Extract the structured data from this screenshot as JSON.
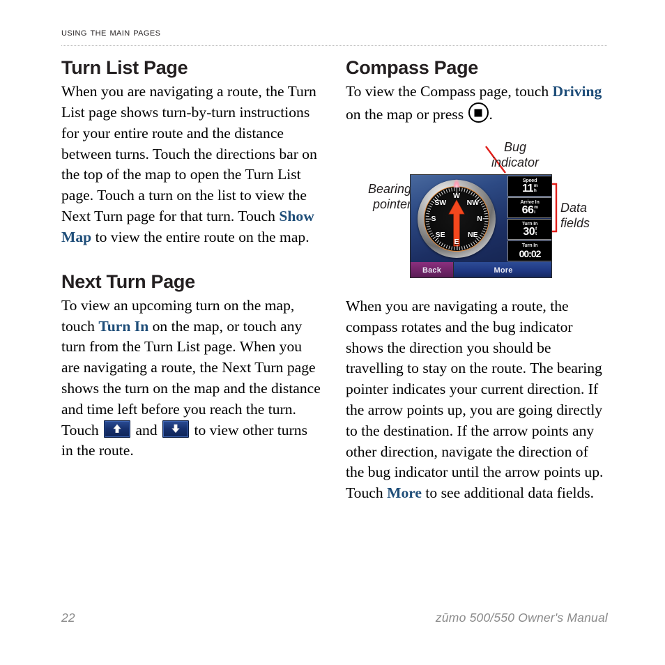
{
  "header": {
    "title": "Using the Main Pages"
  },
  "left_column": {
    "section1": {
      "title": "Turn List Page",
      "paragraph_part1": "When you are navigating a route, the Turn List page shows turn-by-turn instructions for your entire route and the distance between turns. Touch the directions bar on the top of the map to open the Turn List page. Touch a turn on the list to view the Next Turn page for that turn. Touch ",
      "link1": "Show Map",
      "paragraph_part2": " to view the entire route on the map."
    },
    "section2": {
      "title": "Next Turn Page",
      "paragraph_part1": "To view an upcoming turn on the map, touch ",
      "link1": "Turn In",
      "paragraph_part2": " on the map, or touch any turn from the Turn List page. When you are navigating a route, the Next Turn page shows the turn on the map and the distance and time left before you reach the turn. Touch ",
      "conjunction": " and ",
      "paragraph_part3": " to view other turns in the route.",
      "up_button_icon": "arrow-up-icon",
      "down_button_icon": "arrow-down-icon"
    }
  },
  "right_column": {
    "section1": {
      "title": "Compass Page",
      "intro_part1": "To view the Compass page, touch ",
      "link1": "Driving",
      "intro_part2": " on the map or press ",
      "page_button_icon": "page-button-icon",
      "intro_part3": "."
    },
    "body": {
      "paragraph_part1": "When you are navigating a route, the compass rotates and the bug indicator shows the direction you should be travelling to stay on the route. The bearing pointer indicates your current direction. If the arrow points up, you are going directly to the destination. If the arrow points any other direction, navigate the direction of the bug indicator until the arrow points up. Touch ",
      "link1": "More",
      "paragraph_part2": " to see additional data fields."
    }
  },
  "figure": {
    "annotations": {
      "bug_indicator": "Bug\nindicator",
      "bug_indicator_line1": "Bug",
      "bug_indicator_line2": "indicator",
      "bearing_pointer_line1": "Bearing",
      "bearing_pointer_line2": "pointer",
      "data_fields_line1": "Data",
      "data_fields_line2": "fields"
    },
    "leader_color": "#e0201b",
    "device": {
      "compass": {
        "rose_labels": [
          "W",
          "NW",
          "N",
          "NE",
          "E",
          "SE",
          "S",
          "SW"
        ],
        "bearing_arrow_color": "#f4481e",
        "bug_indicator_color": "#ffb3c6",
        "bezel_color": "#b0b0b0",
        "face_ring_color": "#e08a3c"
      },
      "data_fields": [
        {
          "label": "Speed",
          "value": "11",
          "unit_top": "m",
          "unit_bottom": "h"
        },
        {
          "label": "Arrive In",
          "value": "66",
          "unit_top": "m",
          "unit_bottom": "i"
        },
        {
          "label": "Turn In",
          "value": "30",
          "unit_top": "f",
          "unit_bottom": "t"
        },
        {
          "label": "Turn In",
          "value": "00:02",
          "unit_top": "",
          "unit_bottom": ""
        }
      ],
      "buttons": {
        "back": "Back",
        "more": "More"
      }
    }
  },
  "footer": {
    "page_number": "22",
    "document_title": "zūmo 500/550 Owner's Manual"
  },
  "colors": {
    "link_blue": "#1f4e79",
    "annotation_red": "#e0201b",
    "footer_gray": "#8a8a8a",
    "text_black": "#231f20"
  }
}
